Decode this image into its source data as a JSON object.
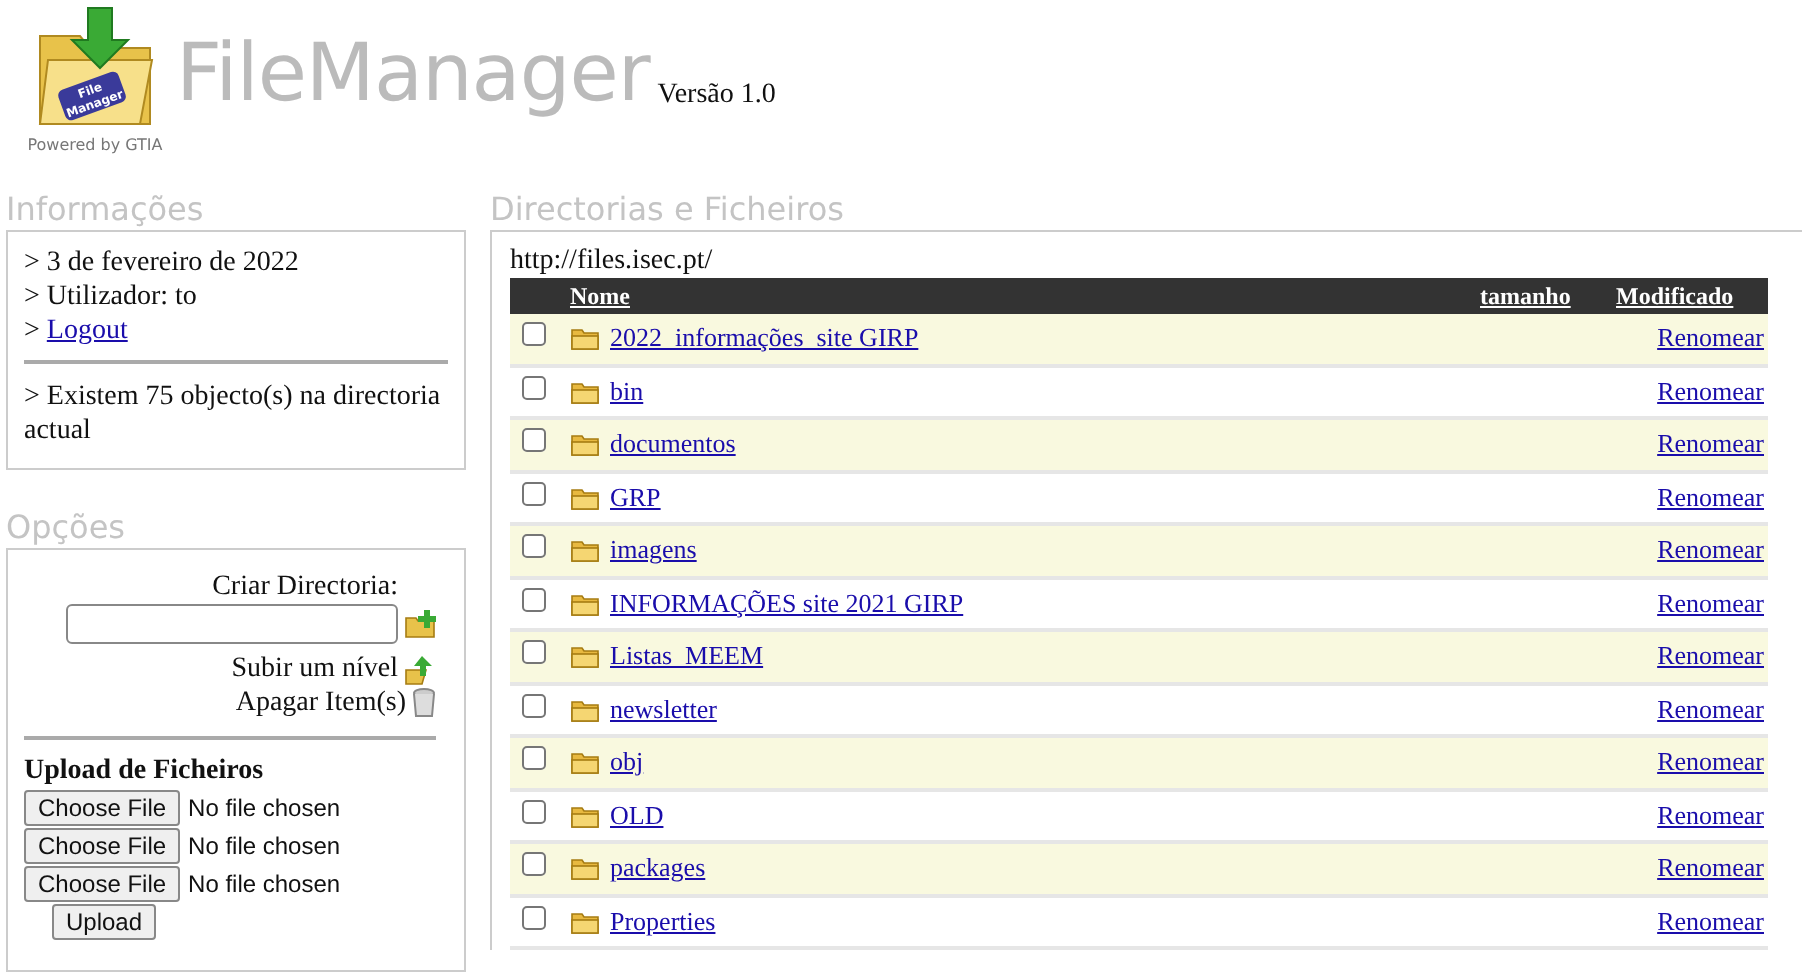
{
  "header": {
    "logo_badge": "File Manager",
    "powered_by": "Powered by GTIA",
    "title": "FileManager",
    "version": "Versão 1.0"
  },
  "info": {
    "title": "Informações",
    "date": "> 3 de fevereiro de 2022",
    "user": "> Utilizador: to",
    "logout_prefix": ">",
    "logout": "Logout",
    "objects": "> Existem 75 objecto(s) na directoria actual"
  },
  "options": {
    "title": "Opções",
    "create_label": "Criar Directoria:",
    "up_label": "Subir um nível",
    "delete_label": "Apagar Item(s)",
    "upload_title": "Upload de Ficheiros",
    "files": [
      {
        "button": "Choose File",
        "status": "No file chosen"
      },
      {
        "button": "Choose File",
        "status": "No file chosen"
      },
      {
        "button": "Choose File",
        "status": "No file chosen"
      }
    ],
    "upload_button": "Upload"
  },
  "files": {
    "title": "Directorias e Ficheiros",
    "path": "http://files.isec.pt/",
    "columns": [
      "Nome",
      "tamanho",
      "Modificado"
    ],
    "rows": [
      {
        "name": "2022_informações_site GIRP",
        "action": "Renomear",
        "checked": false
      },
      {
        "name": "bin",
        "action": "Renomear",
        "checked": false
      },
      {
        "name": "documentos",
        "action": "Renomear",
        "checked": false
      },
      {
        "name": "GRP",
        "action": "Renomear",
        "checked": false
      },
      {
        "name": "imagens",
        "action": "Renomear",
        "checked": false
      },
      {
        "name": "INFORMAÇÕES site 2021 GIRP",
        "action": "Renomear",
        "checked": false
      },
      {
        "name": "Listas_MEEM",
        "action": "Renomear",
        "checked": false
      },
      {
        "name": "newsletter",
        "action": "Renomear",
        "checked": false
      },
      {
        "name": "obj",
        "action": "Renomear",
        "checked": false
      },
      {
        "name": "OLD",
        "action": "Renomear",
        "checked": false
      },
      {
        "name": "packages",
        "action": "Renomear",
        "checked": false
      },
      {
        "name": "Properties",
        "action": "Renomear",
        "checked": false
      }
    ]
  }
}
